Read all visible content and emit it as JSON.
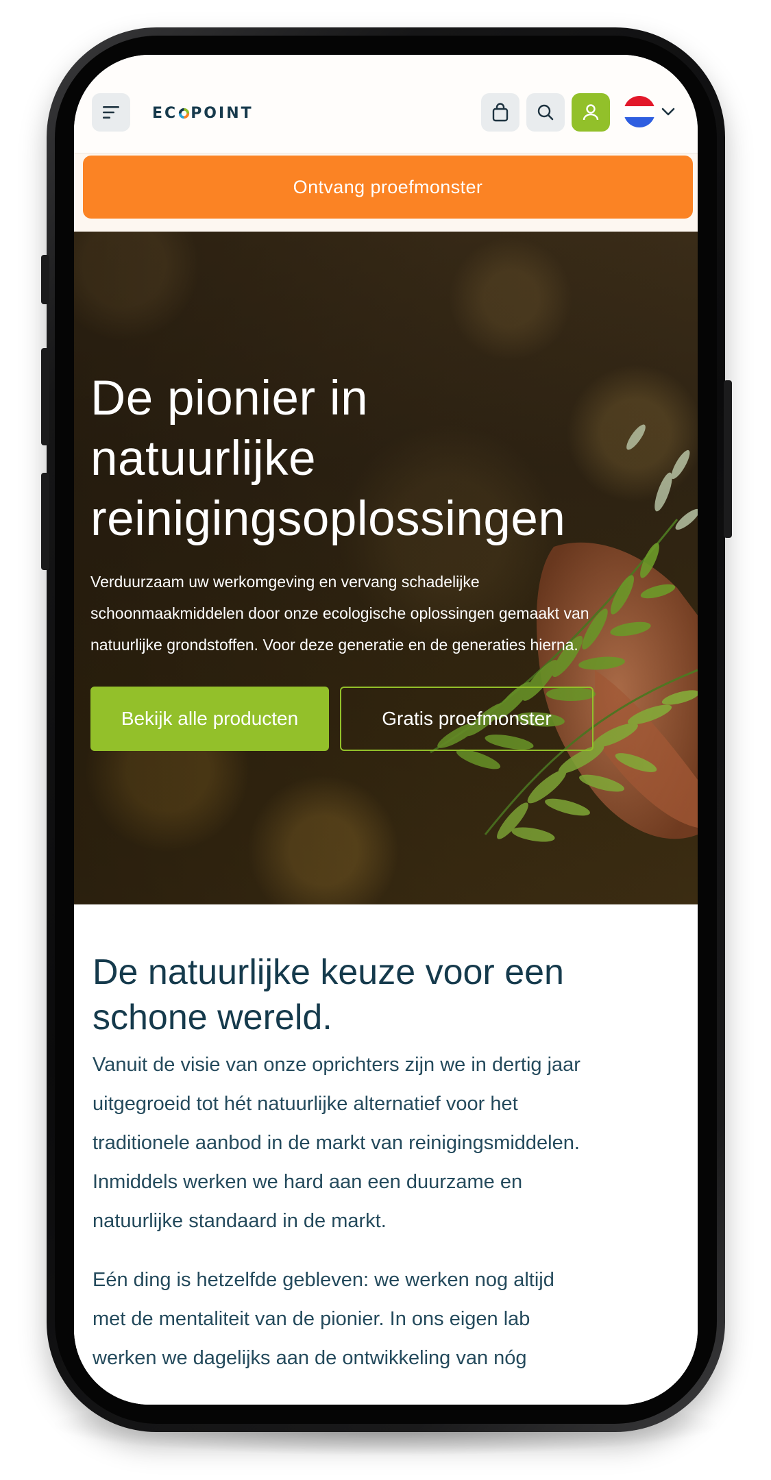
{
  "header": {
    "logo_text": "ECOPOINT",
    "logo_prefix": "EC",
    "logo_suffix": "POINT",
    "icons": [
      "menu-icon",
      "shopping-bag-icon",
      "search-icon",
      "user-icon",
      "dutch-flag-icon",
      "chevron-down-icon"
    ],
    "account_color": "#92c02a",
    "flag_colors": [
      "#e2182a",
      "#ffffff",
      "#2e5ee0"
    ]
  },
  "sample_bar": {
    "label": "Ontvang proefmonster",
    "color": "#fb8324"
  },
  "hero": {
    "title_lines": [
      "De pionier in",
      "natuurlijke",
      "reinigingsoplossingen"
    ],
    "subtitle_lines": [
      "Verduurzaam uw werkomgeving en vervang schadelijke",
      "schoonmaakmiddelen door onze ecologische oplossingen gemaakt van",
      "natuurlijke grondstoffen. Voor deze generatie en de generaties hierna."
    ],
    "primary_cta": "Bekijk alle producten",
    "secondary_cta": "Gratis proefmonster",
    "accent_color": "#93c02a"
  },
  "content": {
    "title_lines": [
      "De natuurlijke keuze voor een",
      "schone wereld."
    ],
    "paragraph1_lines": [
      "Vanuit de visie van onze oprichters zijn we in dertig jaar",
      "uitgegroeid tot hét natuurlijke alternatief voor het",
      "traditionele aanbod in de markt van reinigingsmiddelen.",
      "Inmiddels werken we hard aan een duurzame en",
      "natuurlijke standaard in de markt."
    ],
    "paragraph2_lines": [
      "Eén ding is hetzelfde gebleven: we werken nog altijd",
      "met de mentaliteit van de pionier. In ons eigen lab",
      "werken we dagelijks aan de ontwikkeling van nóg"
    ],
    "text_color": "#153a4c"
  }
}
